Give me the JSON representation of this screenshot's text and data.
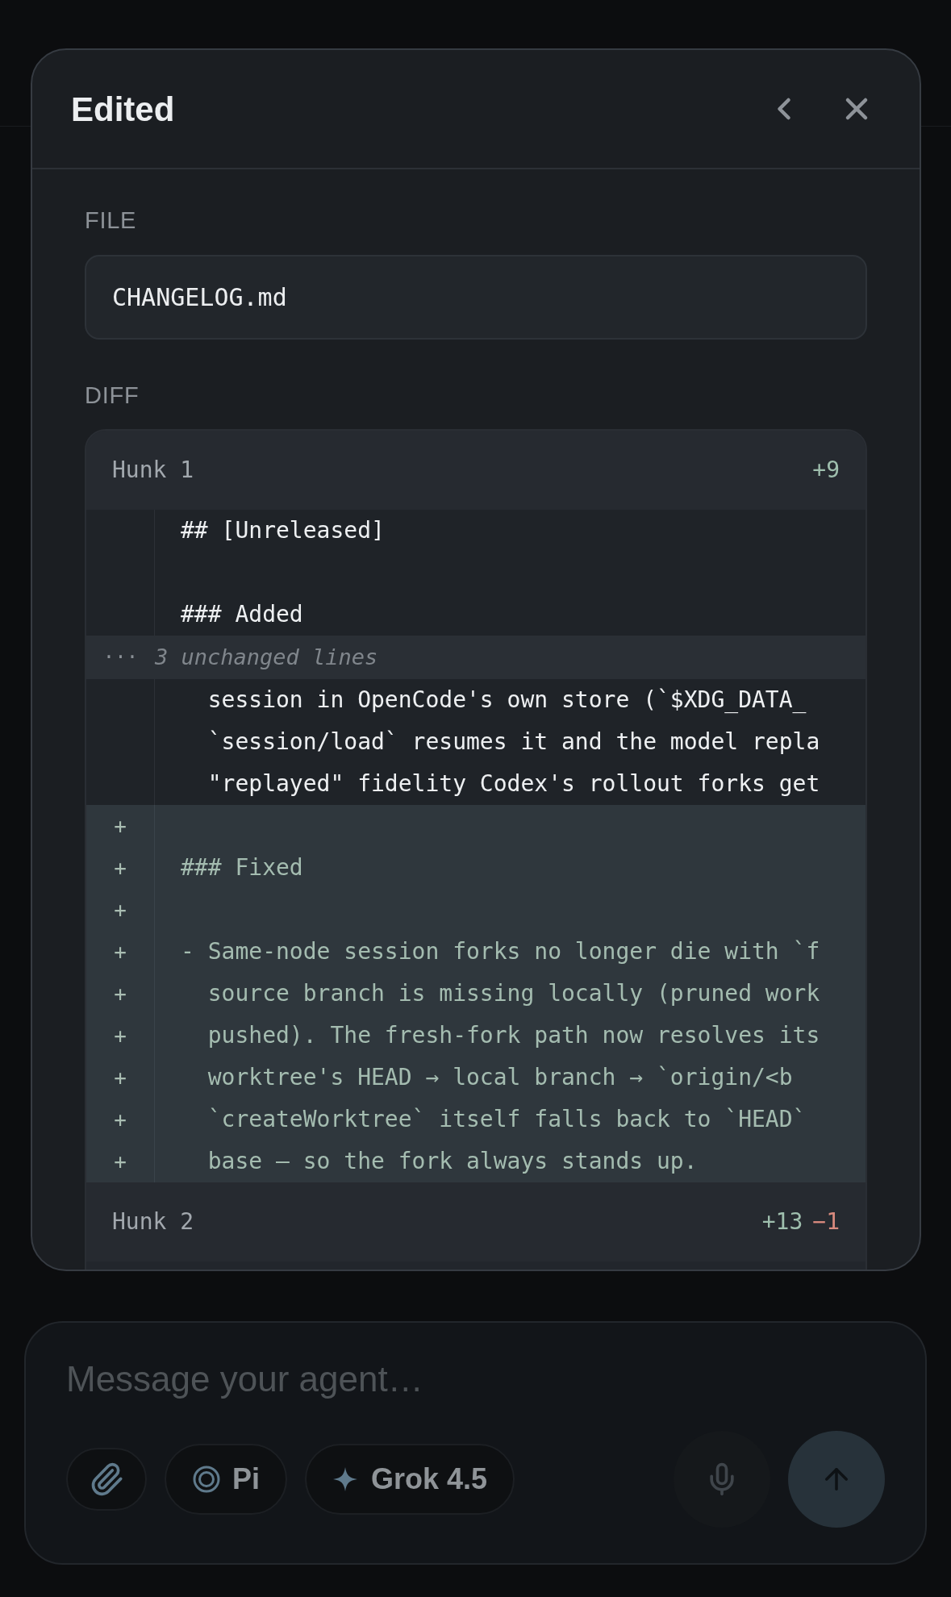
{
  "dialog": {
    "title": "Edited",
    "file": {
      "label": "FILE",
      "value": "CHANGELOG.md"
    },
    "diff": {
      "label": "DIFF",
      "hunks": [
        {
          "label": "Hunk 1",
          "additions": "+9",
          "lines": [
            {
              "kind": "context",
              "text": "## [Unreleased]"
            },
            {
              "kind": "context"
            },
            {
              "kind": "context",
              "text": "### Added"
            },
            {
              "kind": "collapsed",
              "marker": "···",
              "text": "3 unchanged lines"
            },
            {
              "kind": "context",
              "text": "  session in OpenCode's own store (`$XDG_DATA_"
            },
            {
              "kind": "context",
              "text": "  `session/load` resumes it and the model repla"
            },
            {
              "kind": "context",
              "text": "  \"replayed\" fidelity Codex's rollout forks get"
            },
            {
              "kind": "added",
              "marker": "+"
            },
            {
              "kind": "added",
              "marker": "+",
              "text": "### Fixed"
            },
            {
              "kind": "added",
              "marker": "+"
            },
            {
              "kind": "added",
              "marker": "+",
              "text": "- Same-node session forks no longer die with `f"
            },
            {
              "kind": "added",
              "marker": "+",
              "text": "  source branch is missing locally (pruned work"
            },
            {
              "kind": "added",
              "marker": "+",
              "text": "  pushed). The fresh-fork path now resolves its"
            },
            {
              "kind": "added",
              "marker": "+",
              "text": "  worktree's HEAD → local branch → `origin/<b"
            },
            {
              "kind": "added",
              "marker": "+",
              "text": "  `createWorktree` itself falls back to `HEAD`"
            },
            {
              "kind": "added",
              "marker": "+",
              "text": "  base — so the fork always stands up."
            }
          ]
        },
        {
          "label": "Hunk 2",
          "additions": "+13",
          "deletions": "−1"
        }
      ]
    }
  },
  "composer": {
    "placeholder": "Message your agent…",
    "agent": "Pi",
    "model": "Grok 4.5"
  }
}
